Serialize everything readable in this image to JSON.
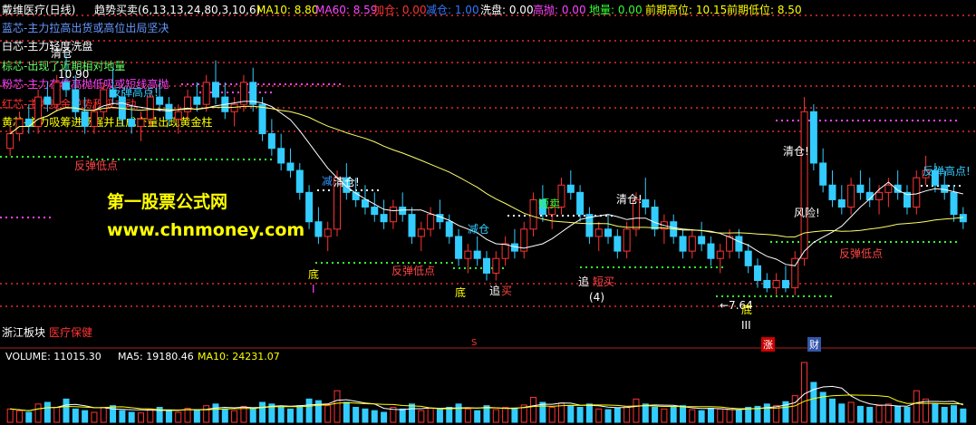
{
  "header": {
    "title": "戴维医疗(日线)",
    "indicator_name": "趋势买卖(6,13,13,24,80,3,10,6)",
    "items": [
      {
        "label": "MA10: 8.80",
        "color": "#ffff00"
      },
      {
        "label": "MA60: 8.59",
        "color": "#ff44ff"
      },
      {
        "label": "加仓: 0.00",
        "color": "#ff3333"
      },
      {
        "label": "减仓: 1.00",
        "color": "#3377ff"
      },
      {
        "label": "洗盘: 0.00",
        "color": "#ffffff"
      },
      {
        "label": "高抛: 0.00",
        "color": "#ff44ff"
      },
      {
        "label": "地量: 0.00",
        "color": "#33ff33"
      },
      {
        "label": "前期高位: 10.15",
        "color": "#ffff00"
      },
      {
        "label": "前期低位: 8.50",
        "color": "#ffff00"
      }
    ]
  },
  "legend": [
    {
      "text": "蓝芯-主力拉高出货或高位出局坚决",
      "color": "#6699ff"
    },
    {
      "text": "白芯-主力轻度洗盘",
      "color": "#ffffff"
    },
    {
      "text": "棕芯-出现了近期相对地量",
      "color": "#66ff66"
    },
    {
      "text": "粉芯-主力在做高抛低吸或短线高抛",
      "color": "#ff44ff"
    },
    {
      "text": "红芯-主力资金逆势积极主动",
      "color": "#ff3333"
    },
    {
      "text": "黄芯-主力吸筹进场强并且成交量出现黄金柱",
      "color": "#ffff00"
    }
  ],
  "watermark": {
    "line1": "第一股票公式网",
    "line2": "www.chnmoney.com"
  },
  "annotations": [
    {
      "text": "清仓",
      "color": "#ffffff"
    },
    {
      "text": "10.90",
      "color": "#ffffff"
    },
    {
      "text": "反弹高点!",
      "color": "#33ccff"
    },
    {
      "text": "反弹低点",
      "color": "#ff4444"
    },
    {
      "text": "减",
      "color": "#3399ff"
    },
    {
      "text": "清仓!",
      "color": "#ffffff"
    },
    {
      "text": "底",
      "color": "#ffff00"
    },
    {
      "text": "I",
      "color": "#ff44ff"
    },
    {
      "text": "反弹低点",
      "color": "#ff4444"
    },
    {
      "text": "减仓",
      "color": "#33ccff"
    },
    {
      "text": "底",
      "color": "#ffff00"
    },
    {
      "text": "追",
      "color": "#ffffff"
    },
    {
      "text": "买",
      "color": "#ff4444"
    },
    {
      "text": "短卖",
      "color": "#33ff33"
    },
    {
      "text": "清仓!",
      "color": "#ffffff"
    },
    {
      "text": "追",
      "color": "#ffffff"
    },
    {
      "text": "短买",
      "color": "#ff4444"
    },
    {
      "text": "(4)",
      "color": "#ffffff"
    },
    {
      "text": "←7.64",
      "color": "#ffffff"
    },
    {
      "text": "底",
      "color": "#ffff00"
    },
    {
      "text": "III",
      "color": "#ffffff"
    },
    {
      "text": "清仓!",
      "color": "#ffffff"
    },
    {
      "text": "风险!",
      "color": "#ffffff"
    },
    {
      "text": "反弹高点!",
      "color": "#33ccff"
    },
    {
      "text": "反弹低点",
      "color": "#ff4444"
    }
  ],
  "bottom_labels": [
    {
      "text": "浙江板块",
      "color": "#ffffff"
    },
    {
      "text": "医疗保健",
      "color": "#ff3333"
    }
  ],
  "event_markers": [
    {
      "text": "S",
      "color": "#ff3333"
    },
    {
      "text": "涨",
      "color": "#ffffff",
      "bg": "#cc0000"
    },
    {
      "text": "财",
      "color": "#ffffff",
      "bg": "#3355aa"
    }
  ],
  "volume_header": [
    {
      "label": "VOLUME: 11015.30",
      "color": "#ffffff"
    },
    {
      "label": "MA5: 19180.46",
      "color": "#ffffff"
    },
    {
      "label": "MA10: 24231.07",
      "color": "#ffff00"
    }
  ],
  "chart_data": {
    "type": "candlestick",
    "title": "戴维医疗(日线)",
    "price_ylim": [
      7.3,
      11.4
    ],
    "candles": [
      [
        9.6,
        9.9,
        9.5,
        9.8
      ],
      [
        9.8,
        10.1,
        9.7,
        10.0
      ],
      [
        10.0,
        10.2,
        9.8,
        9.9
      ],
      [
        9.9,
        10.4,
        9.8,
        10.3
      ],
      [
        10.3,
        10.5,
        10.1,
        10.2
      ],
      [
        10.2,
        10.6,
        10.1,
        10.5
      ],
      [
        10.5,
        10.9,
        10.3,
        10.4
      ],
      [
        10.4,
        10.6,
        10.0,
        10.1
      ],
      [
        10.1,
        10.3,
        9.8,
        9.9
      ],
      [
        9.9,
        10.2,
        9.8,
        10.1
      ],
      [
        10.1,
        10.5,
        10.0,
        10.4
      ],
      [
        10.4,
        10.7,
        10.2,
        10.3
      ],
      [
        10.3,
        10.4,
        9.9,
        10.0
      ],
      [
        10.0,
        10.2,
        9.8,
        9.9
      ],
      [
        9.9,
        10.1,
        9.7,
        10.0
      ],
      [
        10.0,
        10.4,
        9.9,
        10.3
      ],
      [
        10.3,
        10.5,
        10.1,
        10.2
      ],
      [
        10.2,
        10.3,
        9.9,
        10.0
      ],
      [
        10.0,
        10.2,
        9.8,
        10.1
      ],
      [
        10.1,
        10.4,
        10.0,
        10.3
      ],
      [
        10.3,
        10.5,
        10.1,
        10.2
      ],
      [
        10.2,
        10.6,
        10.1,
        10.5
      ],
      [
        10.5,
        10.8,
        10.2,
        10.3
      ],
      [
        10.3,
        10.5,
        10.0,
        10.1
      ],
      [
        10.1,
        10.3,
        9.9,
        10.2
      ],
      [
        10.2,
        10.6,
        10.1,
        10.5
      ],
      [
        10.5,
        10.7,
        10.1,
        10.2
      ],
      [
        10.2,
        10.3,
        9.7,
        9.8
      ],
      [
        9.8,
        10.0,
        9.5,
        9.6
      ],
      [
        9.6,
        9.8,
        9.3,
        9.4
      ],
      [
        9.4,
        9.6,
        9.2,
        9.3
      ],
      [
        9.3,
        9.4,
        8.9,
        9.0
      ],
      [
        9.0,
        9.1,
        8.5,
        8.6
      ],
      [
        8.6,
        8.8,
        8.3,
        8.4
      ],
      [
        8.4,
        8.6,
        8.2,
        8.5
      ],
      [
        8.5,
        9.3,
        8.4,
        9.2
      ],
      [
        9.2,
        9.4,
        8.9,
        9.0
      ],
      [
        9.0,
        9.2,
        8.8,
        8.9
      ],
      [
        8.9,
        9.1,
        8.7,
        8.8
      ],
      [
        8.8,
        9.0,
        8.6,
        8.7
      ],
      [
        8.7,
        8.9,
        8.5,
        8.6
      ],
      [
        8.6,
        8.9,
        8.5,
        8.8
      ],
      [
        8.8,
        9.0,
        8.6,
        8.7
      ],
      [
        8.7,
        8.8,
        8.3,
        8.4
      ],
      [
        8.4,
        8.6,
        8.2,
        8.5
      ],
      [
        8.5,
        8.8,
        8.4,
        8.7
      ],
      [
        8.7,
        8.9,
        8.5,
        8.6
      ],
      [
        8.6,
        8.7,
        8.3,
        8.4
      ],
      [
        8.4,
        8.5,
        8.0,
        8.1
      ],
      [
        8.1,
        8.3,
        7.9,
        8.2
      ],
      [
        8.2,
        8.4,
        8.0,
        8.1
      ],
      [
        8.1,
        8.2,
        7.8,
        7.9
      ],
      [
        7.9,
        8.2,
        7.8,
        8.1
      ],
      [
        8.1,
        8.4,
        8.0,
        8.3
      ],
      [
        8.3,
        8.5,
        8.1,
        8.2
      ],
      [
        8.2,
        8.6,
        8.1,
        8.5
      ],
      [
        8.5,
        9.0,
        8.4,
        8.9
      ],
      [
        8.9,
        9.1,
        8.6,
        8.7
      ],
      [
        8.7,
        8.9,
        8.5,
        8.8
      ],
      [
        8.8,
        9.2,
        8.7,
        9.1
      ],
      [
        9.1,
        9.3,
        8.9,
        9.0
      ],
      [
        9.0,
        9.1,
        8.6,
        8.7
      ],
      [
        8.7,
        8.8,
        8.3,
        8.4
      ],
      [
        8.4,
        8.6,
        8.2,
        8.5
      ],
      [
        8.5,
        8.7,
        8.3,
        8.4
      ],
      [
        8.4,
        8.5,
        8.1,
        8.2
      ],
      [
        8.2,
        8.6,
        8.1,
        8.5
      ],
      [
        8.5,
        9.0,
        8.4,
        8.9
      ],
      [
        8.9,
        9.2,
        8.7,
        8.8
      ],
      [
        8.8,
        8.9,
        8.4,
        8.5
      ],
      [
        8.5,
        8.7,
        8.3,
        8.6
      ],
      [
        8.6,
        8.7,
        8.3,
        8.4
      ],
      [
        8.4,
        8.5,
        8.1,
        8.2
      ],
      [
        8.2,
        8.5,
        8.1,
        8.4
      ],
      [
        8.4,
        8.6,
        8.2,
        8.3
      ],
      [
        8.3,
        8.4,
        8.0,
        8.1
      ],
      [
        8.1,
        8.3,
        7.9,
        8.2
      ],
      [
        8.2,
        8.5,
        8.1,
        8.4
      ],
      [
        8.4,
        8.5,
        8.1,
        8.2
      ],
      [
        8.2,
        8.3,
        7.9,
        8.0
      ],
      [
        8.0,
        8.1,
        7.7,
        7.8
      ],
      [
        7.8,
        7.9,
        7.64,
        7.7
      ],
      [
        7.7,
        7.9,
        7.6,
        7.8
      ],
      [
        7.8,
        8.0,
        7.64,
        7.7
      ],
      [
        7.7,
        8.2,
        7.6,
        8.1
      ],
      [
        8.1,
        10.3,
        8.0,
        10.1
      ],
      [
        10.1,
        10.2,
        9.3,
        9.4
      ],
      [
        9.4,
        9.6,
        9.0,
        9.1
      ],
      [
        9.1,
        9.3,
        8.8,
        8.9
      ],
      [
        8.9,
        9.1,
        8.7,
        8.8
      ],
      [
        8.8,
        9.2,
        8.7,
        9.1
      ],
      [
        9.1,
        9.3,
        8.9,
        9.0
      ],
      [
        9.0,
        9.2,
        8.8,
        8.9
      ],
      [
        8.9,
        9.1,
        8.7,
        9.0
      ],
      [
        9.0,
        9.2,
        8.8,
        9.1
      ],
      [
        9.1,
        9.3,
        8.9,
        9.0
      ],
      [
        9.0,
        9.1,
        8.7,
        8.8
      ],
      [
        8.8,
        9.3,
        8.7,
        9.2
      ],
      [
        9.2,
        9.5,
        9.1,
        9.3
      ],
      [
        9.3,
        9.4,
        9.0,
        9.1
      ],
      [
        9.1,
        9.3,
        8.9,
        9.0
      ],
      [
        9.0,
        9.1,
        8.6,
        8.7
      ],
      [
        8.7,
        8.8,
        8.5,
        8.6
      ]
    ],
    "volume": [
      40,
      35,
      30,
      55,
      60,
      45,
      70,
      40,
      35,
      30,
      45,
      50,
      35,
      30,
      28,
      40,
      45,
      35,
      30,
      42,
      38,
      50,
      55,
      40,
      35,
      48,
      42,
      60,
      55,
      45,
      40,
      50,
      70,
      65,
      50,
      95,
      60,
      45,
      40,
      35,
      30,
      45,
      40,
      55,
      35,
      42,
      38,
      45,
      55,
      40,
      35,
      50,
      38,
      45,
      40,
      52,
      75,
      60,
      45,
      58,
      50,
      45,
      55,
      40,
      38,
      42,
      48,
      70,
      55,
      45,
      40,
      45,
      50,
      38,
      35,
      42,
      40,
      38,
      35,
      45,
      48,
      55,
      50,
      62,
      80,
      180,
      120,
      90,
      70,
      55,
      60,
      48,
      45,
      50,
      55,
      48,
      45,
      95,
      70,
      55,
      45,
      50,
      40
    ],
    "ma10_series": "yellow",
    "ma60_series": "white",
    "ylabel": "",
    "xlabel": ""
  }
}
